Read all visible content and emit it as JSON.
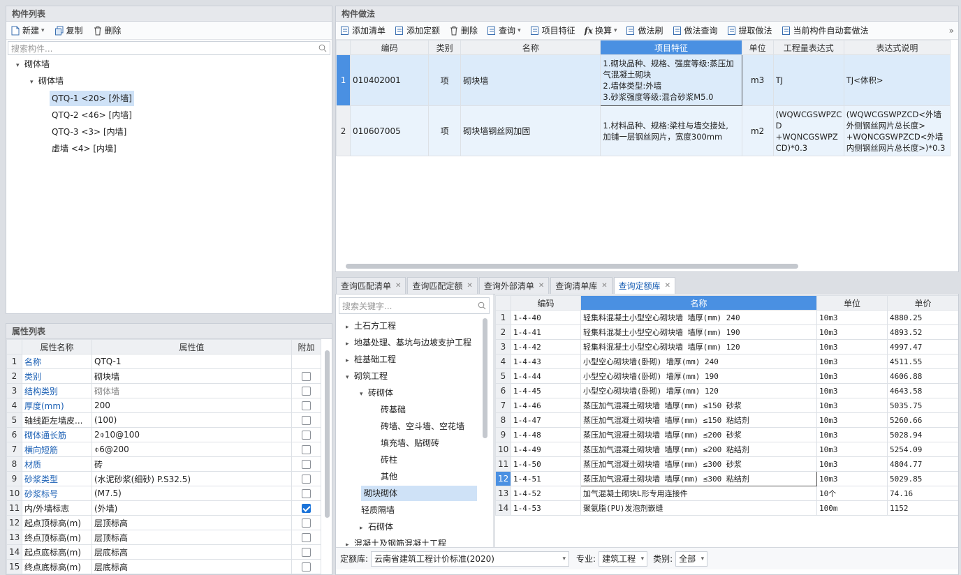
{
  "left_top": {
    "title": "构件列表",
    "toolbar": {
      "new": "新建",
      "copy": "复制",
      "delete": "删除"
    },
    "search_placeholder": "搜索构件...",
    "tree": {
      "root": "砌体墙",
      "child": "砌体墙",
      "leaves": [
        "QTQ-1 <20> [外墙]",
        "QTQ-2 <46> [内墙]",
        "QTQ-3 <3> [内墙]",
        "虚墙 <4> [内墙]"
      ]
    }
  },
  "props": {
    "title": "属性列表",
    "headers": [
      "属性名称",
      "属性值",
      "附加"
    ],
    "rows": [
      {
        "n": "1",
        "name": "名称",
        "value": "QTQ-1",
        "link": true,
        "gray": false,
        "cb": "none"
      },
      {
        "n": "2",
        "name": "类别",
        "value": "砌块墙",
        "link": true,
        "gray": false,
        "cb": "off"
      },
      {
        "n": "3",
        "name": "结构类别",
        "value": "砌体墙",
        "link": true,
        "gray": true,
        "cb": "off"
      },
      {
        "n": "4",
        "name": "厚度(mm)",
        "value": "200",
        "link": true,
        "gray": false,
        "cb": "off"
      },
      {
        "n": "5",
        "name": "轴线距左墙皮...",
        "value": "(100)",
        "link": false,
        "gray": false,
        "cb": "off"
      },
      {
        "n": "6",
        "name": "砌体通长筋",
        "value": "2⌽10@100",
        "link": true,
        "gray": false,
        "cb": "off"
      },
      {
        "n": "7",
        "name": "横向短筋",
        "value": "⌽6@200",
        "link": true,
        "gray": false,
        "cb": "off"
      },
      {
        "n": "8",
        "name": "材质",
        "value": "砖",
        "link": true,
        "gray": false,
        "cb": "off"
      },
      {
        "n": "9",
        "name": "砂浆类型",
        "value": "(水泥砂浆(细砂) P.S32.5)",
        "link": true,
        "gray": false,
        "cb": "off"
      },
      {
        "n": "10",
        "name": "砂浆标号",
        "value": "(M7.5)",
        "link": true,
        "gray": false,
        "cb": "off"
      },
      {
        "n": "11",
        "name": "内/外墙标志",
        "value": "(外墙)",
        "link": false,
        "gray": false,
        "cb": "on"
      },
      {
        "n": "12",
        "name": "起点顶标高(m)",
        "value": "层顶标高",
        "link": false,
        "gray": false,
        "cb": "off"
      },
      {
        "n": "13",
        "name": "终点顶标高(m)",
        "value": "层顶标高",
        "link": false,
        "gray": false,
        "cb": "off"
      },
      {
        "n": "14",
        "name": "起点底标高(m)",
        "value": "层底标高",
        "link": false,
        "gray": false,
        "cb": "off"
      },
      {
        "n": "15",
        "name": "终点底标高(m)",
        "value": "层底标高",
        "link": false,
        "gray": false,
        "cb": "off"
      }
    ]
  },
  "method": {
    "title": "构件做法",
    "toolbar": [
      "添加清单",
      "添加定额",
      "删除",
      "查询",
      "项目特征",
      "换算",
      "做法刷",
      "做法查询",
      "提取做法",
      "当前构件自动套做法"
    ],
    "more": "»",
    "headers": [
      "编码",
      "类别",
      "名称",
      "项目特征",
      "单位",
      "工程量表达式",
      "表达式说明"
    ],
    "rows": [
      {
        "n": "1",
        "code": "010402001",
        "cat": "项",
        "name": "砌块墙",
        "feature": [
          "1.砌块品种、规格、强度等级:蒸压加",
          "气混凝土砌块",
          "2.墙体类型:外墙",
          "3.砂浆强度等级:混合砂浆M5.0"
        ],
        "unit": "m3",
        "expr": [
          "TJ"
        ],
        "desc": [
          "TJ<体积>"
        ]
      },
      {
        "n": "2",
        "code": "010607005",
        "cat": "项",
        "name": "砌块墙钢丝网加固",
        "feature": [
          "1.材料品种、规格:梁柱与墙交接处,",
          "加铺一层钢丝网片，宽度300mm"
        ],
        "unit": "m2",
        "expr": [
          "(WQWCGSWPZC",
          "D",
          "+WQNCGSWPZ",
          "CD)*0.3"
        ],
        "desc": [
          "(WQWCGSWPZCD<外墙",
          "外侧钢丝网片总长度>",
          "+WQNCGSWPZCD<外墙",
          "内侧钢丝网片总长度>)*0.3"
        ]
      }
    ]
  },
  "query": {
    "tabs": [
      "查询匹配清单",
      "查询匹配定额",
      "查询外部清单",
      "查询清单库",
      "查询定额库"
    ],
    "active_tab": 4,
    "search_placeholder": "搜索关键字...",
    "tree": [
      {
        "label": "土石方工程",
        "level": 0,
        "arrow": "▸"
      },
      {
        "label": "地基处理、基坑与边坡支护工程",
        "level": 0,
        "arrow": "▸"
      },
      {
        "label": "桩基础工程",
        "level": 0,
        "arrow": "▸"
      },
      {
        "label": "砌筑工程",
        "level": 0,
        "arrow": "▾"
      },
      {
        "label": "砖砌体",
        "level": 1,
        "arrow": "▾"
      },
      {
        "label": "砖基础",
        "level": 2,
        "arrow": ""
      },
      {
        "label": "砖墙、空斗墙、空花墙",
        "level": 2,
        "arrow": ""
      },
      {
        "label": "填充墙、贴砌砖",
        "level": 2,
        "arrow": ""
      },
      {
        "label": "砖柱",
        "level": 2,
        "arrow": ""
      },
      {
        "label": "其他",
        "level": 2,
        "arrow": ""
      },
      {
        "label": "砌块砌体",
        "level": 1,
        "arrow": ""
      },
      {
        "label": "轻质隔墙",
        "level": 1,
        "arrow": ""
      },
      {
        "label": "石砌体",
        "level": 1,
        "arrow": "▸"
      },
      {
        "label": "混凝土及钢筋混凝土工程",
        "level": 0,
        "arrow": "▸"
      }
    ],
    "headers": [
      "编码",
      "名称",
      "单位",
      "单价"
    ],
    "rows": [
      {
        "n": "1",
        "code": "1-4-40",
        "name": "轻集料混凝土小型空心砌块墙 墙厚(mm) 240",
        "unit": "10m3",
        "price": "4880.25"
      },
      {
        "n": "2",
        "code": "1-4-41",
        "name": "轻集料混凝土小型空心砌块墙 墙厚(mm) 190",
        "unit": "10m3",
        "price": "4893.52"
      },
      {
        "n": "3",
        "code": "1-4-42",
        "name": "轻集料混凝土小型空心砌块墙 墙厚(mm) 120",
        "unit": "10m3",
        "price": "4997.47"
      },
      {
        "n": "4",
        "code": "1-4-43",
        "name": "小型空心砌块墙(卧砌) 墙厚(mm) 240",
        "unit": "10m3",
        "price": "4511.55"
      },
      {
        "n": "5",
        "code": "1-4-44",
        "name": "小型空心砌块墙(卧砌) 墙厚(mm) 190",
        "unit": "10m3",
        "price": "4606.88"
      },
      {
        "n": "6",
        "code": "1-4-45",
        "name": "小型空心砌块墙(卧砌) 墙厚(mm) 120",
        "unit": "10m3",
        "price": "4643.58"
      },
      {
        "n": "7",
        "code": "1-4-46",
        "name": "蒸压加气混凝土砌块墙 墙厚(mm) ≤150 砂浆",
        "unit": "10m3",
        "price": "5035.75"
      },
      {
        "n": "8",
        "code": "1-4-47",
        "name": "蒸压加气混凝土砌块墙 墙厚(mm) ≤150 粘结剂",
        "unit": "10m3",
        "price": "5260.66"
      },
      {
        "n": "9",
        "code": "1-4-48",
        "name": "蒸压加气混凝土砌块墙 墙厚(mm) ≤200 砂浆",
        "unit": "10m3",
        "price": "5028.94"
      },
      {
        "n": "10",
        "code": "1-4-49",
        "name": "蒸压加气混凝土砌块墙 墙厚(mm) ≤200 粘结剂",
        "unit": "10m3",
        "price": "5254.09"
      },
      {
        "n": "11",
        "code": "1-4-50",
        "name": "蒸压加气混凝土砌块墙 墙厚(mm) ≤300 砂浆",
        "unit": "10m3",
        "price": "4804.77"
      },
      {
        "n": "12",
        "code": "1-4-51",
        "name": "蒸压加气混凝土砌块墙 墙厚(mm) ≤300 粘结剂",
        "unit": "10m3",
        "price": "5029.85"
      },
      {
        "n": "13",
        "code": "1-4-52",
        "name": "加气混凝土砌块L形专用连接件",
        "unit": "10个",
        "price": "74.16"
      },
      {
        "n": "14",
        "code": "1-4-53",
        "name": "聚氨脂(PU)发泡剂嵌缝",
        "unit": "100m",
        "price": "1152"
      }
    ],
    "footer": {
      "lib_label": "定额库:",
      "lib_value": "云南省建筑工程计价标准(2020)",
      "major_label": "专业:",
      "major_value": "建筑工程",
      "cat_label": "类别:",
      "cat_value": "全部"
    }
  },
  "colors": {
    "accent": "#1a73d9",
    "selected_row": "#dcebfa",
    "header_highlight": "#4a90e2"
  }
}
